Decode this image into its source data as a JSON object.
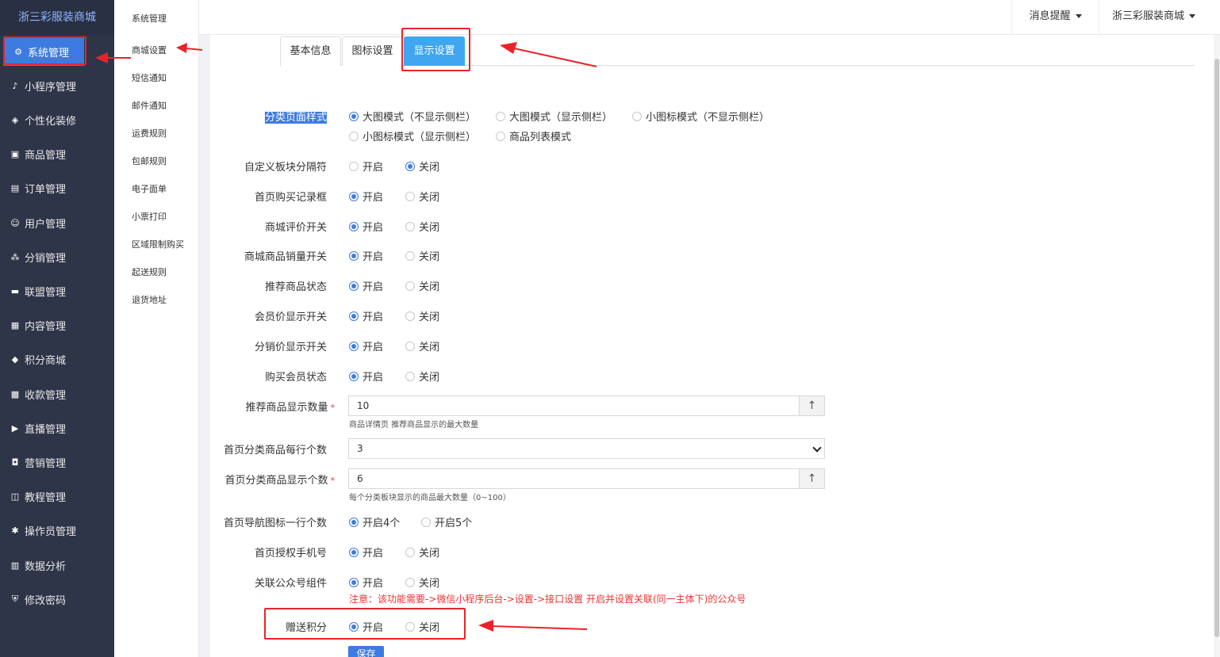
{
  "brand": "浙三彩服装商城",
  "sidebar": {
    "items": [
      {
        "label": "系统管理",
        "icon": "gear-icon",
        "glyph": "⚙"
      },
      {
        "label": "小程序管理",
        "icon": "tiktok-icon",
        "glyph": "♪"
      },
      {
        "label": "个性化装修",
        "icon": "diamond-icon",
        "glyph": "◈"
      },
      {
        "label": "商品管理",
        "icon": "bag-icon",
        "glyph": "▣"
      },
      {
        "label": "订单管理",
        "icon": "clipboard-icon",
        "glyph": "▤"
      },
      {
        "label": "用户管理",
        "icon": "user-icon",
        "glyph": "☺"
      },
      {
        "label": "分销管理",
        "icon": "sitemap-icon",
        "glyph": "⁂"
      },
      {
        "label": "联盟管理",
        "icon": "card-icon",
        "glyph": "▬"
      },
      {
        "label": "内容管理",
        "icon": "article-icon",
        "glyph": "▦"
      },
      {
        "label": "积分商城",
        "icon": "cube-icon",
        "glyph": "◆"
      },
      {
        "label": "收款管理",
        "icon": "grid-icon",
        "glyph": "▩"
      },
      {
        "label": "直播管理",
        "icon": "play-icon",
        "glyph": "▶"
      },
      {
        "label": "营销管理",
        "icon": "cart-icon",
        "glyph": "◘"
      },
      {
        "label": "教程管理",
        "icon": "book-icon",
        "glyph": "◫"
      },
      {
        "label": "操作员管理",
        "icon": "cog-icon",
        "glyph": "✱"
      },
      {
        "label": "数据分析",
        "icon": "chart-icon",
        "glyph": "▥"
      },
      {
        "label": "修改密码",
        "icon": "shield-icon",
        "glyph": "⛨"
      }
    ]
  },
  "submenu": {
    "items": [
      "系统管理",
      "商城设置",
      "短信通知",
      "邮件通知",
      "运费规则",
      "包邮规则",
      "电子面单",
      "小票打印",
      "区域限制购买",
      "起送规则",
      "退货地址"
    ]
  },
  "header": {
    "messages": "消息提醒",
    "shop": "浙三彩服装商城"
  },
  "tabs": [
    "基本信息",
    "图标设置",
    "显示设置"
  ],
  "form": {
    "category_style": {
      "label": "分类页面样式",
      "options": [
        "大图模式（不显示侧栏）",
        "大图模式（显示侧栏）",
        "小图标模式（不显示侧栏）",
        "小图标模式（显示侧栏）",
        "商品列表模式"
      ]
    },
    "toggles": [
      {
        "label": "自定义板块分隔符",
        "on": "开启",
        "off": "关闭",
        "value": "off"
      },
      {
        "label": "首页购买记录框",
        "on": "开启",
        "off": "关闭",
        "value": "on"
      },
      {
        "label": "商城评价开关",
        "on": "开启",
        "off": "关闭",
        "value": "on"
      },
      {
        "label": "商城商品销量开关",
        "on": "开启",
        "off": "关闭",
        "value": "on"
      },
      {
        "label": "推荐商品状态",
        "on": "开启",
        "off": "关闭",
        "value": "on"
      },
      {
        "label": "会员价显示开关",
        "on": "开启",
        "off": "关闭",
        "value": "on"
      },
      {
        "label": "分销价显示开关",
        "on": "开启",
        "off": "关闭",
        "value": "on"
      },
      {
        "label": "购买会员状态",
        "on": "开启",
        "off": "关闭",
        "value": "on"
      }
    ],
    "rec_count": {
      "label": "推荐商品显示数量",
      "value": "10",
      "hint": "商品详情页 推荐商品显示的最大数量"
    },
    "per_row": {
      "label": "首页分类商品每行个数",
      "value": "3"
    },
    "cat_count": {
      "label": "首页分类商品显示个数",
      "value": "6",
      "hint": "每个分类板块显示的商品最大数量（0~100）"
    },
    "nav_icons": {
      "label": "首页导航图标一行个数",
      "opt1": "开启4个",
      "opt2": "开启5个"
    },
    "auth_phone": {
      "label": "首页授权手机号",
      "on": "开启",
      "off": "关闭"
    },
    "official": {
      "label": "关联公众号组件",
      "on": "开启",
      "off": "关闭",
      "notice": "注意：该功能需要->微信小程序后台->设置->接口设置 开启并设置关联(同一主体下)的公众号"
    },
    "points": {
      "label": "赠送积分",
      "on": "开启",
      "off": "关闭"
    },
    "save": "保存"
  },
  "colors": {
    "sidebar_bg": "#2f3548",
    "accent": "#3d7be0",
    "tab_active": "#3ea7f0",
    "annotation": "#e8242a"
  }
}
